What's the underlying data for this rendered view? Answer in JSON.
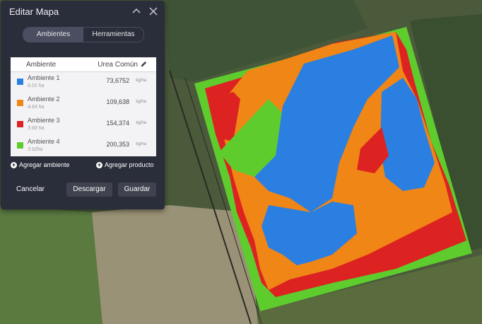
{
  "panel": {
    "title": "Editar Mapa",
    "tabs": [
      {
        "label": "Ambientes",
        "active": true
      },
      {
        "label": "Herramientas",
        "active": false
      }
    ],
    "table": {
      "col_ambiente": "Ambiente",
      "col_producto": "Urea Común",
      "rows": [
        {
          "name": "Ambiente 1",
          "area": "6.01 ha",
          "value": "73,6752",
          "unit": "kg/ha",
          "color": "#2b7fe0"
        },
        {
          "name": "Ambiente 2",
          "area": "4.64 ha",
          "value": "109,638",
          "unit": "kg/ha",
          "color": "#f08616"
        },
        {
          "name": "Ambiente 3",
          "area": "3.68 ha",
          "value": "154,374",
          "unit": "kg/ha",
          "color": "#dd2222"
        },
        {
          "name": "Ambiente 4",
          "area": "3.92ha",
          "value": "200,353",
          "unit": "kg/ha",
          "color": "#5fcc2e"
        }
      ]
    },
    "add_ambiente": "Agregar ambiente",
    "add_producto": "Agregar producto",
    "cancel": "Cancelar",
    "download": "Descargar",
    "save": "Guardar"
  },
  "colors": {
    "panel_bg": "#2a2d3a",
    "zone_blue": "#2b7fe0",
    "zone_orange": "#f08616",
    "zone_red": "#dd2222",
    "zone_green": "#5fcc2e"
  },
  "icons": {
    "collapse": "chevron-up-icon",
    "close": "close-icon",
    "edit": "pencil-icon",
    "add": "plus-circle-icon"
  }
}
